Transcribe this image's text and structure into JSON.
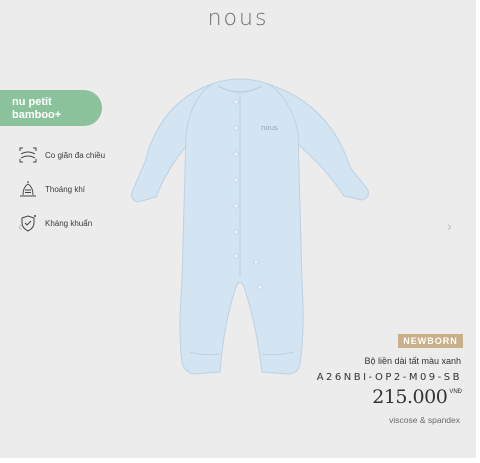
{
  "brand": {
    "logo_text": "nous"
  },
  "collection_badge": {
    "line1": "nu petit",
    "line2": "bamboo+",
    "color": "#8cc29b"
  },
  "features": [
    {
      "icon": "stretch-arrows-icon",
      "label": "Co giãn đa chiều"
    },
    {
      "icon": "breathable-wind-icon",
      "label": "Thoáng khí"
    },
    {
      "icon": "antibacterial-shield-icon",
      "label": "Kháng khuẩn"
    }
  ],
  "carousel": {
    "prev_icon": "‹",
    "next_icon": "›"
  },
  "product": {
    "category_tag": "NEWBORN",
    "tag_color": "#c9b08a",
    "name": "Bộ liền dài tất màu xanh",
    "sku": "A26NBI-OP2-M09-SB",
    "price": "215.000",
    "currency": "VNĐ",
    "material": "viscose & spandex",
    "garment_color": "#d3e4f3",
    "chest_logo": "nous"
  }
}
